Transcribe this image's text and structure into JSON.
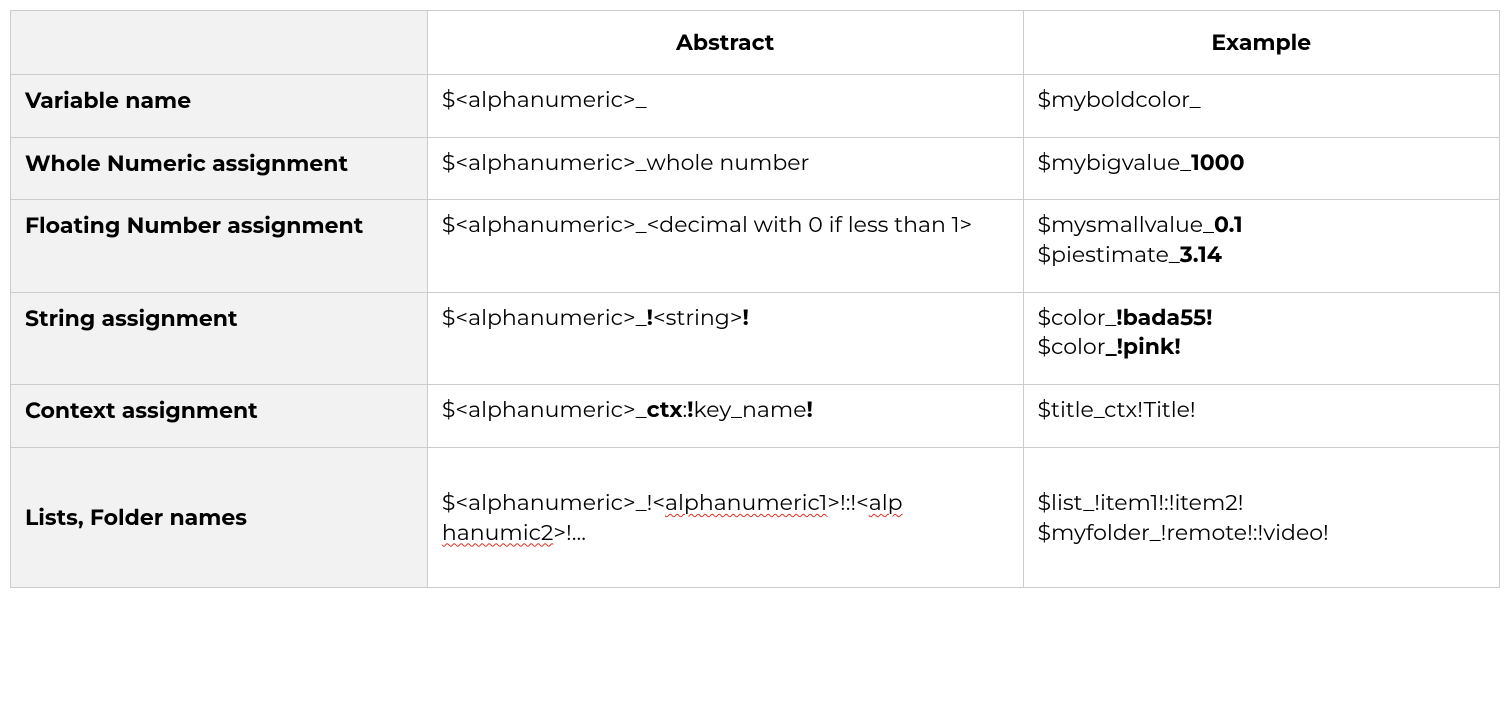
{
  "headers": {
    "abstract": "Abstract",
    "example": "Example"
  },
  "rows": {
    "variable": {
      "name": " Variable name",
      "abstract": "$<alphanumeric>_",
      "example": "$myboldcolor_"
    },
    "whole": {
      "name": "Whole Numeric assignment",
      "abstract": "$<alphanumeric>_whole number",
      "example_pre": "$mybigvalue_",
      "example_bold": "1000"
    },
    "float": {
      "name": "Floating Number assignment",
      "abstract": "$<alphanumeric>_<decimal with 0 if less than 1>",
      "ex1_pre": "$mysmallvalue_",
      "ex1_bold": "0.1",
      "ex2_pre": "$piestimate_",
      "ex2_bold": "3.14"
    },
    "string": {
      "name": "String assignment",
      "ab_pre": "$<alphanumeric>_",
      "ab_b1": "!",
      "ab_mid": "<string>",
      "ab_b2": "!",
      "ex1_pre": "$color_",
      "ex1_bold": "!bada55!",
      "ex2_pre": "$color",
      "ex2_bold": "_!pink!"
    },
    "context": {
      "name": "Context assignment",
      "ab_pre": "$<alphanumeric>_",
      "ab_b1": "ctx",
      "ab_mid1": ":",
      "ab_b2": "!",
      "ab_mid2": "key_name",
      "ab_b3": "!",
      "example": "$title_ctx!Title!"
    },
    "lists": {
      "name": "Lists, Folder names",
      "ab_1": "$<alphanumeric>_!<",
      "ab_sq1": "alphanumeric1",
      "ab_2": ">!:!<",
      "ab_sq2": "alp",
      "ab_sq3": "hanumic2",
      "ab_3": ">!…",
      "ex1": "$list_!item1!:!item2!",
      "ex2": "$myfolder_!remote!:!video!"
    }
  }
}
